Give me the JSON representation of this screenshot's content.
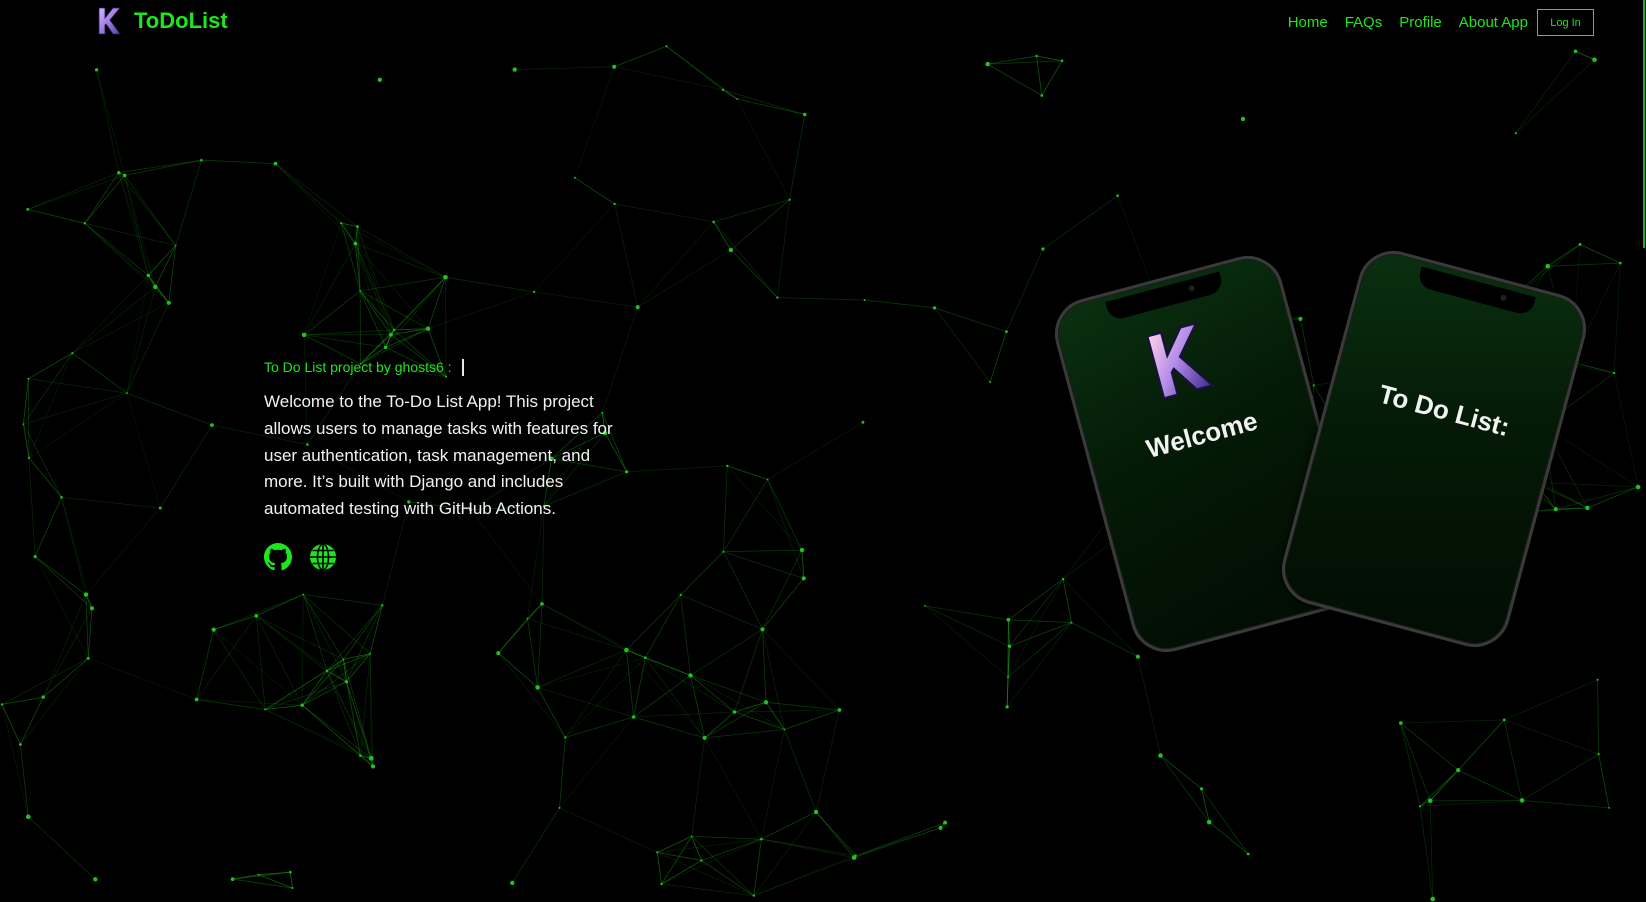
{
  "brand": {
    "name": "ToDoList",
    "logo_letter": "K",
    "logo_icon": "k-logo-icon"
  },
  "nav": {
    "links": [
      "Home",
      "FAQs",
      "Profile",
      "About App"
    ],
    "login_label": "Log In"
  },
  "hero": {
    "subtitle": "To Do List project by ghosts6 :",
    "description": "Welcome to the To-Do List App! This project allows users to manage tasks with features for user authentication, task management, and more. It’s built with Django and includes automated testing with GitHub Actions.",
    "social": [
      {
        "icon": "github-icon"
      },
      {
        "icon": "globe-icon"
      }
    ]
  },
  "phones": [
    {
      "title": "Welcome",
      "logo_letter": "K"
    },
    {
      "title": "To Do List:"
    }
  ],
  "colors": {
    "background": "#000000",
    "accent": "#1ee61e",
    "text": "#f2f2f2",
    "network_line": "#1aa01a"
  }
}
